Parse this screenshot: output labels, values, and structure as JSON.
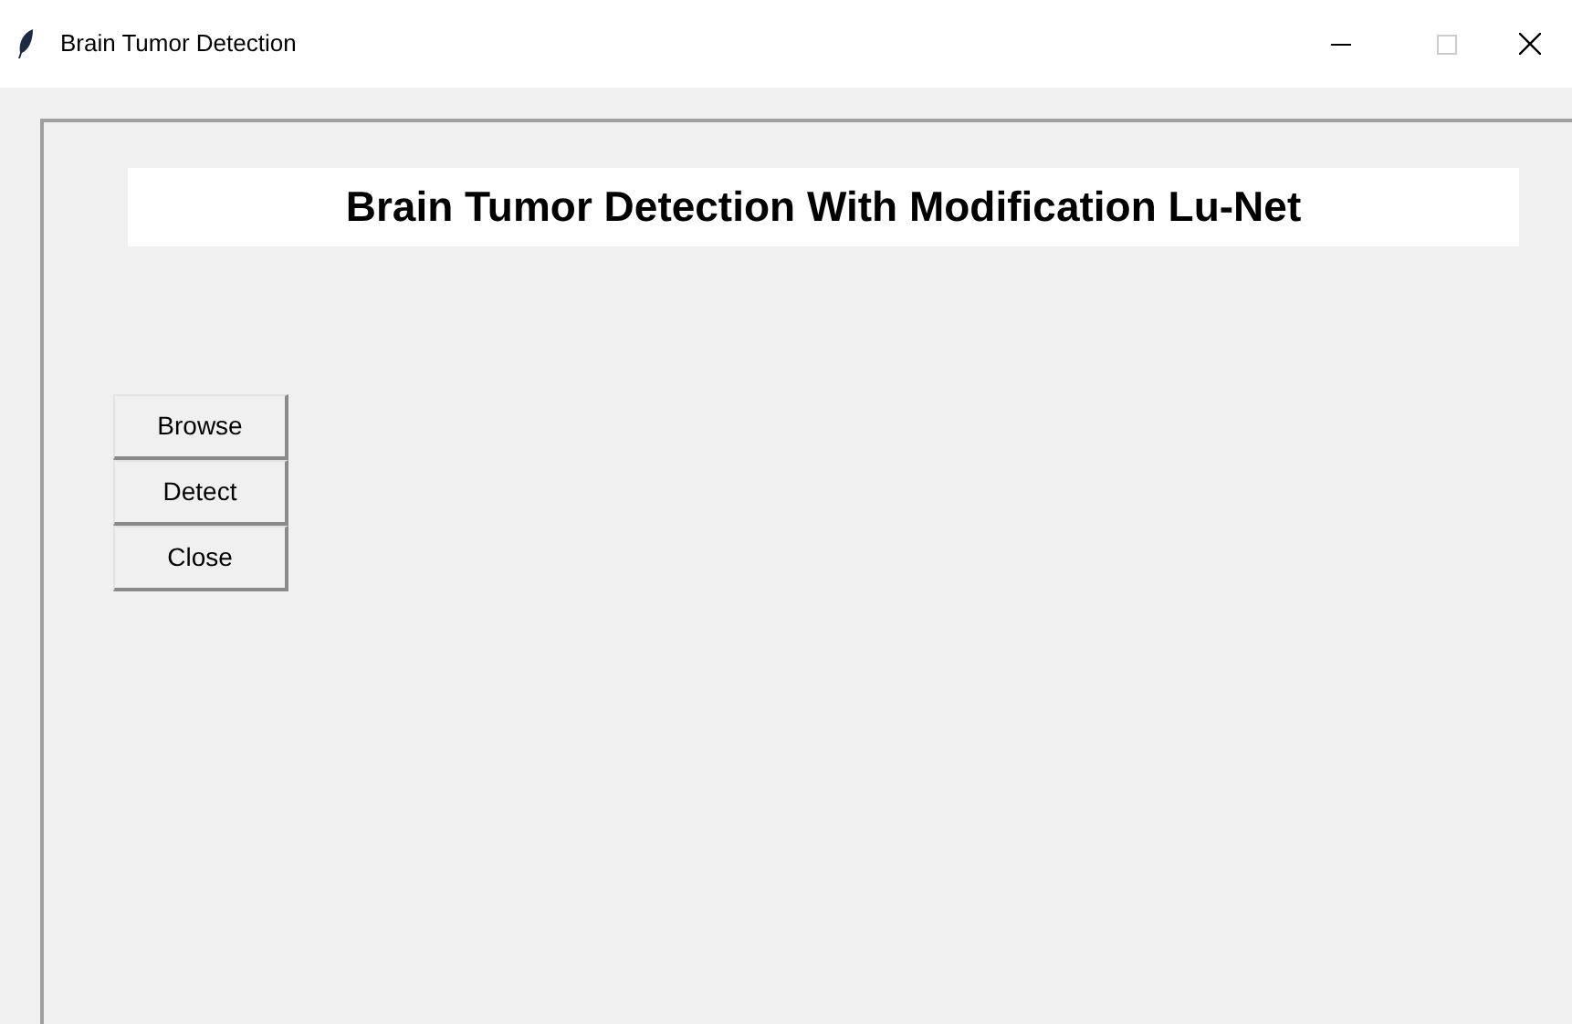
{
  "window": {
    "title": "Brain Tumor Detection",
    "maximize_disabled": true
  },
  "heading": "Brain Tumor Detection With Modification Lu-Net",
  "buttons": [
    "Browse",
    "Detect",
    "Close"
  ]
}
